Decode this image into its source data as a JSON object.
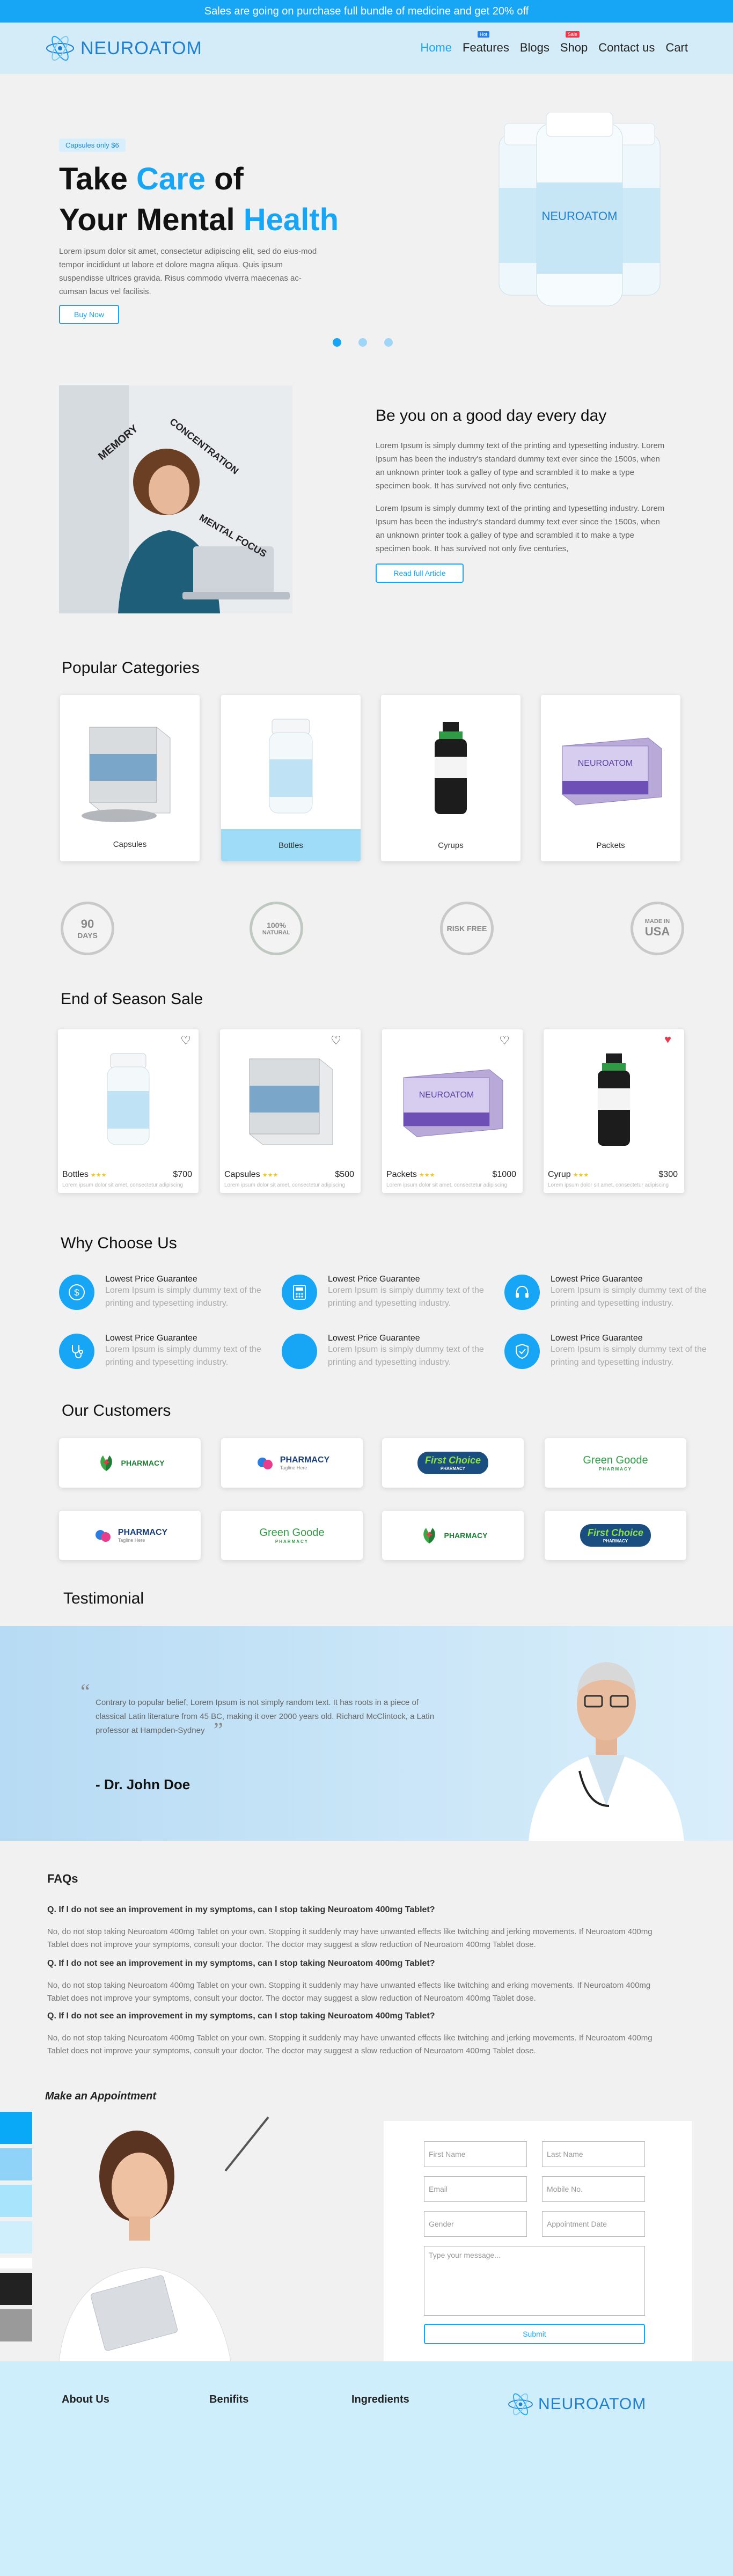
{
  "announcement": "Sales are going on purchase full bundle of medicine and get 20% off",
  "brand": {
    "name": "NEUROATOM"
  },
  "nav": {
    "items": [
      {
        "label": "Home",
        "badge": ""
      },
      {
        "label": "Features",
        "badge": "Hot"
      },
      {
        "label": "Blogs",
        "badge": ""
      },
      {
        "label": "Shop",
        "badge": "Sale"
      },
      {
        "label": "Contact us",
        "badge": ""
      },
      {
        "label": "Cart",
        "badge": ""
      }
    ]
  },
  "colors": {
    "accent": "#17a6f5",
    "hot_badge": "#2a7de1",
    "sale_badge": "#e8394d",
    "heart_active": "#e8394d"
  },
  "hero": {
    "tag": "Capsules only $6",
    "title_line1_a": "Take ",
    "title_line1_b": "Care",
    "title_line1_c": " of",
    "title_line2_a": "Your Mental ",
    "title_line2_b": "Health",
    "description": "Lorem ipsum dolor sit amet, consectetur adipiscing elit, sed do eius-mod tempor incididunt ut labore et dolore magna aliqua. Quis ipsum suspendisse ultrices gravida. Risus commodo viverra maecenas ac-cumsan lacus vel facilisis.",
    "button": "Buy Now",
    "bottle_label": "NEUROATOM",
    "active_slide": 1,
    "slides": 3
  },
  "article": {
    "title": "Be you on a good day every day",
    "para1": "Lorem Ipsum is simply dummy text of the printing and typesetting industry. Lorem Ipsum has been the industry's standard dummy text ever since the 1500s, when an unknown printer took a galley of type and scrambled it to make a type specimen book. It has survived not only five centuries,",
    "para2": "Lorem Ipsum is simply dummy text of the printing and typesetting industry. Lorem Ipsum has been the industry's standard dummy text ever since the 1500s, when an unknown printer took a galley of type and scrambled it to make a type specimen book. It has survived not only five centuries,",
    "button": "Read full Article",
    "image_words": [
      "MEMORY",
      "CONCENTRATION",
      "MENTAL FOCUS"
    ]
  },
  "categories": {
    "title": "Popular Categories",
    "items": [
      {
        "label": "Capsules",
        "active": false
      },
      {
        "label": "Bottles",
        "active": true
      },
      {
        "label": "Cyrups",
        "active": false
      },
      {
        "label": "Packets",
        "active": false
      }
    ]
  },
  "seals": [
    {
      "line1": "90",
      "line2": "DAYS"
    },
    {
      "line1": "100%",
      "line2": "NATURAL"
    },
    {
      "line1": "RISK FREE",
      "line2": ""
    },
    {
      "line1": "MADE IN",
      "line2": "USA"
    }
  ],
  "sale": {
    "title": "End of Season Sale",
    "items": [
      {
        "name": "Bottles",
        "price": "$700",
        "stars": "★★★",
        "sub": "Lorem ipsum dolor sit amet, consectetur adipiscing",
        "liked": false
      },
      {
        "name": "Capsules",
        "price": "$500",
        "stars": "★★★",
        "sub": "Lorem ipsum dolor sit amet, consectetur adipiscing",
        "liked": false
      },
      {
        "name": "Packets",
        "price": "$1000",
        "stars": "★★★",
        "sub": "Lorem ipsum dolor sit amet, consectetur adipiscing",
        "liked": false
      },
      {
        "name": "Cyrup",
        "price": "$300",
        "stars": "★★★",
        "sub": "Lorem ipsum dolor sit amet, consectetur adipiscing",
        "liked": true
      }
    ]
  },
  "why": {
    "title": "Why Choose Us",
    "items": [
      {
        "title": "Lowest Price Guarantee",
        "text": "Lorem Ipsum is simply dummy text of the printing and typesetting industry.",
        "icon": "dollar-icon"
      },
      {
        "title": "Lowest Price Guarantee",
        "text": "Lorem Ipsum is simply dummy text of the printing and typesetting industry.",
        "icon": "calculator-icon"
      },
      {
        "title": "Lowest Price Guarantee",
        "text": "Lorem Ipsum is simply dummy text of the printing and typesetting industry.",
        "icon": "headset-icon"
      },
      {
        "title": "Lowest Price Guarantee",
        "text": "Lorem Ipsum is simply dummy text of the printing and typesetting industry.",
        "icon": "stethoscope-icon"
      },
      {
        "title": "Lowest Price Guarantee",
        "text": "Lorem Ipsum is simply dummy text of the printing and typesetting industry.",
        "icon": "blank-icon"
      },
      {
        "title": "Lowest Price Guarantee",
        "text": "Lorem Ipsum is simply dummy text of the printing and typesetting industry.",
        "icon": "shield-icon"
      }
    ]
  },
  "customers": {
    "title": "Our Customers",
    "logos": [
      {
        "name": "PHARMACY",
        "sub": "",
        "kind": "leaf"
      },
      {
        "name": "PHARMACY",
        "sub": "Tagline Here",
        "kind": "pill"
      },
      {
        "name": "First Choice",
        "sub": "PHARMACY",
        "kind": "badge"
      },
      {
        "name": "Green Goode",
        "sub": "PHARMACY",
        "kind": "green"
      },
      {
        "name": "PHARMACY",
        "sub": "Tagline Here",
        "kind": "pill"
      },
      {
        "name": "Green Goode",
        "sub": "PHARMACY",
        "kind": "green"
      },
      {
        "name": "PHARMACY",
        "sub": "",
        "kind": "leaf"
      },
      {
        "name": "First Choice",
        "sub": "PHARMACY",
        "kind": "badge"
      }
    ]
  },
  "testimonial": {
    "title": "Testimonial",
    "quote": "Contrary to popular belief, Lorem Ipsum is not simply random text. It has roots in a piece of classical Latin literature from 45 BC, making it over 2000 years old. Richard McClintock, a Latin professor at Hampden-Sydney",
    "author": "- Dr. John Doe"
  },
  "faq": {
    "title": "FAQs",
    "items": [
      {
        "q": "Q. If I do not see an improvement in my symptoms, can I stop taking Neuroatom 400mg Tablet?",
        "a": "No, do not stop taking Neuroatom 400mg Tablet on your own. Stopping it suddenly may have unwanted effects like twitching and jerking movements. If Neuroatom 400mg Tablet does not improve your symptoms, consult your doctor. The doctor may suggest a slow reduction of Neuroatom 400mg Tablet dose."
      },
      {
        "q": "Q. If I do not see an improvement in my symptoms, can I stop taking Neuroatom 400mg Tablet?",
        "a": "No, do not stop taking Neuroatom 400mg Tablet on your own. Stopping it suddenly may have unwanted effects like twitching and erking movements. If Neuroatom 400mg Tablet does not improve your symptoms, consult your doctor. The doctor may suggest a slow reduction of Neuroatom 400mg Tablet dose."
      },
      {
        "q": "Q. If I do not see an improvement in my symptoms, can I stop taking Neuroatom 400mg Tablet?",
        "a": "No, do not stop taking Neuroatom 400mg Tablet on your own. Stopping it suddenly may have unwanted effects like twitching and jerking movements. If Neuroatom 400mg Tablet does not improve your symptoms, consult your doctor. The doctor may suggest a slow reduction of Neuroatom 400mg Tablet dose."
      }
    ]
  },
  "appointment": {
    "title": "Make an Appointment",
    "first_name": "First Name",
    "last_name": "Last Name",
    "email": "Email",
    "mobile": "Mobile No.",
    "gender": "Gender",
    "date": "Appointment Date",
    "message": "Type your message...",
    "submit": "Submit",
    "swatches": [
      "#0aa9f7",
      "#8fd3f8",
      "#a8e4fb",
      "#cfeffc",
      "#ffffff",
      "#222222",
      "#9a9a9a"
    ]
  },
  "footer": {
    "links": [
      "About Us",
      "Benifits",
      "Ingredients"
    ]
  }
}
